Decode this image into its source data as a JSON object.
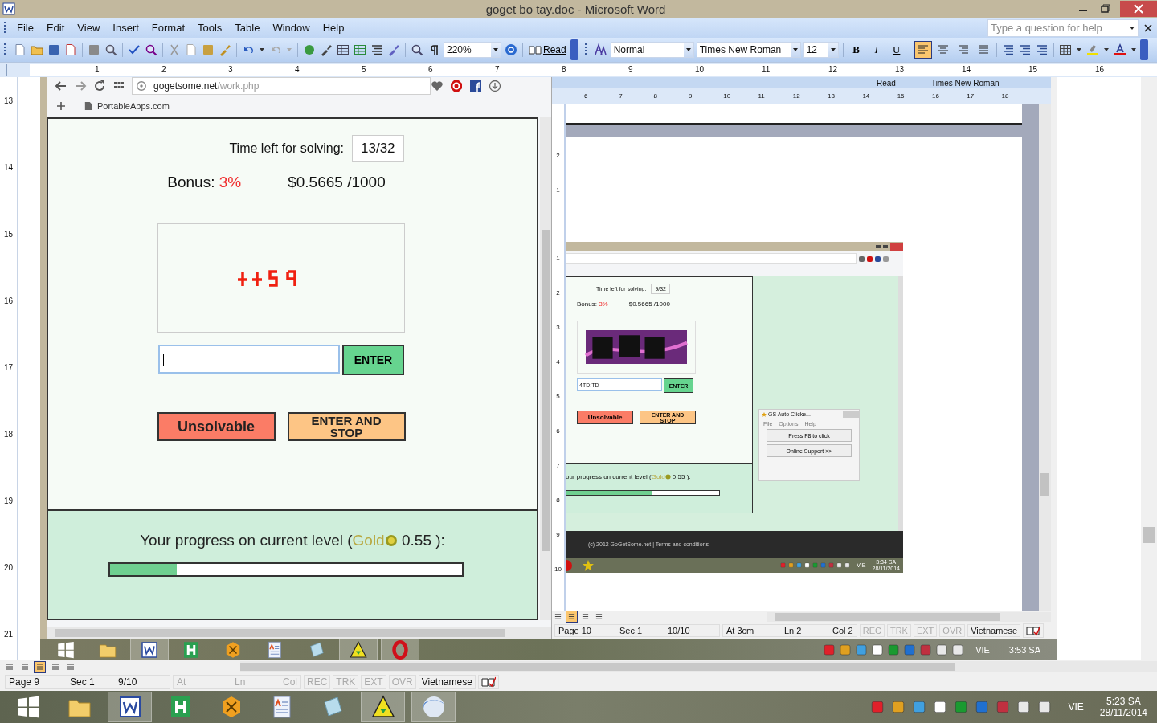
{
  "window": {
    "title": "goget bo tay.doc - Microsoft Word"
  },
  "menu": [
    "File",
    "Edit",
    "View",
    "Insert",
    "Format",
    "Tools",
    "Table",
    "Window",
    "Help"
  ],
  "help_field": {
    "placeholder": "Type a question for help"
  },
  "toolbar": {
    "zoom": "220%",
    "read": "Read",
    "style": "Normal",
    "font": "Times New Roman",
    "size": "12",
    "format_buttons": [
      {
        "label": "B",
        "kind": "bold"
      },
      {
        "label": "I",
        "kind": "italic"
      },
      {
        "label": "U",
        "kind": "underline"
      }
    ],
    "alignment": [
      {
        "kind": "left",
        "selected": true
      },
      {
        "kind": "center",
        "selected": false
      },
      {
        "kind": "right",
        "selected": false
      },
      {
        "kind": "justify",
        "selected": false
      }
    ]
  },
  "ruler": {
    "numbers": [
      "1",
      "2",
      "3",
      "4",
      "5",
      "6",
      "7",
      "8",
      "9",
      "10",
      "11",
      "12",
      "13",
      "14",
      "15",
      "16"
    ]
  },
  "vertical_ruler": {
    "numbers": [
      "13",
      "14",
      "15",
      "16",
      "17",
      "18",
      "19",
      "20",
      "21"
    ]
  },
  "browser": {
    "url_host": "gogetsome.net",
    "url_path": "/work.php",
    "bookmark": "PortableApps.com",
    "time_label": "Time left for solving:",
    "time_value": "13/32",
    "bonus_label": "Bonus:",
    "bonus_value": "3%",
    "earnings": "$0.5665 /1000",
    "enter": "ENTER",
    "unsolvable": "Unsolvable",
    "enter_and_stop": "ENTER AND STOP",
    "progress_prefix": "Your progress on current level (",
    "progress_level_name": "Gold",
    "progress_suffix": "0.55 ):",
    "level": 0.19
  },
  "nested_word": {
    "toolbar_read": "Read",
    "toolbar_font": "Times New Roman",
    "ruler_numbers": [
      "6",
      "7",
      "8",
      "9",
      "10",
      "11",
      "12",
      "13",
      "14",
      "15",
      "16",
      "17",
      "18"
    ],
    "vertical_ruler_numbers": [
      "2",
      "1",
      "1",
      "2",
      "3",
      "4",
      "5",
      "6",
      "7",
      "8",
      "9",
      "10"
    ],
    "inner_browser": {
      "time_label": "Time left for solving:",
      "time_value": "9/32",
      "bonus_label": "Bonus:",
      "bonus_value": "3%",
      "earnings": "$0.5665 /1000",
      "answer_value": "4TD:TD",
      "enter": "ENTER",
      "unsolvable": "Unsolvable",
      "enter_and_stop": "ENTER AND STOP",
      "progress_prefix": "our progress on current level (",
      "progress_level_name": "Gold",
      "progress_suffix": "0.55 ):",
      "level": 0.56,
      "footer": "(c) 2012 GoGetSome.net  |  Terms and conditions"
    },
    "auto_clicker": {
      "title": "GS Auto Clicke...",
      "menu": [
        "File",
        "Options",
        "Help"
      ],
      "buttons": [
        "Press F8 to click",
        "Online Support >>"
      ]
    },
    "inner_taskbar": {
      "language": "VIE",
      "time": "3:34 SA",
      "date": "28/11/2014"
    },
    "status_bar": {
      "page": "Page 10",
      "section": "Sec 1",
      "pages": "10/10",
      "at": "At 3cm",
      "ln": "Ln 2",
      "col": "Col 2",
      "position_disabled": false,
      "modes": [
        {
          "label": "REC",
          "disabled": true
        },
        {
          "label": "TRK",
          "disabled": true
        },
        {
          "label": "EXT",
          "disabled": true
        },
        {
          "label": "OVR",
          "disabled": true
        }
      ],
      "language": "Vietnamese"
    },
    "view_buttons": [
      {
        "selected": false
      },
      {
        "selected": true
      },
      {
        "selected": false
      },
      {
        "selected": false
      }
    ]
  },
  "embedded_taskbar": {
    "apps": [
      {
        "kind": "start",
        "active": false
      },
      {
        "kind": "folder",
        "active": false
      },
      {
        "kind": "word",
        "active": true
      },
      {
        "kind": "h-app",
        "active": false
      },
      {
        "kind": "hex-app",
        "active": false
      },
      {
        "kind": "document",
        "active": false
      },
      {
        "kind": "notepad",
        "active": false
      },
      {
        "kind": "triangle-app",
        "active": true
      },
      {
        "kind": "opera",
        "active": true
      }
    ],
    "language": "VIE",
    "time": "3:53 SA"
  },
  "view_buttons": [
    {
      "selected": false
    },
    {
      "selected": false
    },
    {
      "selected": true
    },
    {
      "selected": false
    },
    {
      "selected": false
    }
  ],
  "status_bar": {
    "page": "Page 9",
    "section": "Sec 1",
    "pages": "9/10",
    "at": "At",
    "ln": "Ln",
    "col": "Col",
    "position_disabled": true,
    "modes": [
      {
        "label": "REC",
        "disabled": true
      },
      {
        "label": "TRK",
        "disabled": true
      },
      {
        "label": "EXT",
        "disabled": true
      },
      {
        "label": "OVR",
        "disabled": true
      }
    ],
    "language": "Vietnamese"
  },
  "taskbar": {
    "apps": [
      {
        "kind": "start",
        "active": false
      },
      {
        "kind": "folder",
        "active": false
      },
      {
        "kind": "word",
        "active": true
      },
      {
        "kind": "h-app",
        "active": false
      },
      {
        "kind": "hex-app",
        "active": false
      },
      {
        "kind": "document",
        "active": false
      },
      {
        "kind": "notepad",
        "active": false
      },
      {
        "kind": "triangle-app",
        "active": true
      },
      {
        "kind": "sphere",
        "active": true
      }
    ],
    "language": "VIE",
    "time": "5:23 SA",
    "date": "28/11/2014"
  }
}
